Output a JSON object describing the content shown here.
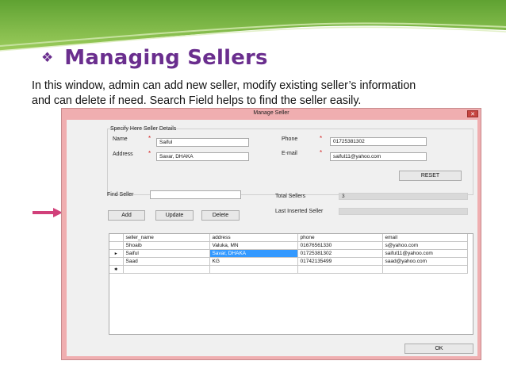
{
  "slide": {
    "title": "Managing Sellers",
    "bullet_icon": "diamond-star-bullet-icon",
    "description_line1": "In this window, admin can add new seller, modify existing seller’s information",
    "description_line2": "and can delete if need. Search Field helps to find the seller easily.",
    "colors": {
      "title": "#6a2e8e",
      "band_green": "#7ab648",
      "arrow": "#d1407a"
    }
  },
  "window": {
    "title": "Manage Seller",
    "close_label": "✕",
    "group_title": "Specify Here Seller Details",
    "name_label": "Name",
    "name_value": "Saiful",
    "address_label": "Address",
    "address_value": "Savar, DHAKA",
    "phone_label": "Phone",
    "phone_value": "01725381302",
    "email_label": "E-mail",
    "email_value": "saiful11@yahoo.com",
    "required_mark": "*",
    "reset_label": "RESET",
    "find_label": "Find Seller",
    "find_value": "",
    "add_label": "Add",
    "update_label": "Update",
    "delete_label": "Delete",
    "total_label": "Total Sellers",
    "total_value": "3",
    "last_label": "Last Inserted Seller",
    "last_value": "",
    "ok_label": "OK"
  },
  "grid": {
    "columns": [
      "seller_name",
      "address",
      "phone",
      "email"
    ],
    "rows": [
      {
        "marker": "",
        "cells": [
          "Shoaib",
          "Valuka, MN",
          "01676561330",
          "s@yahoo.com"
        ]
      },
      {
        "marker": "►",
        "cells": [
          "Saiful",
          "Savar, DHAKA",
          "01725381302",
          "saiful11@yahoo.com"
        ]
      },
      {
        "marker": "",
        "cells": [
          "Saad",
          "KG",
          "01742135499",
          "saad@yahoo.com"
        ]
      }
    ],
    "new_row_marker": "✱"
  }
}
